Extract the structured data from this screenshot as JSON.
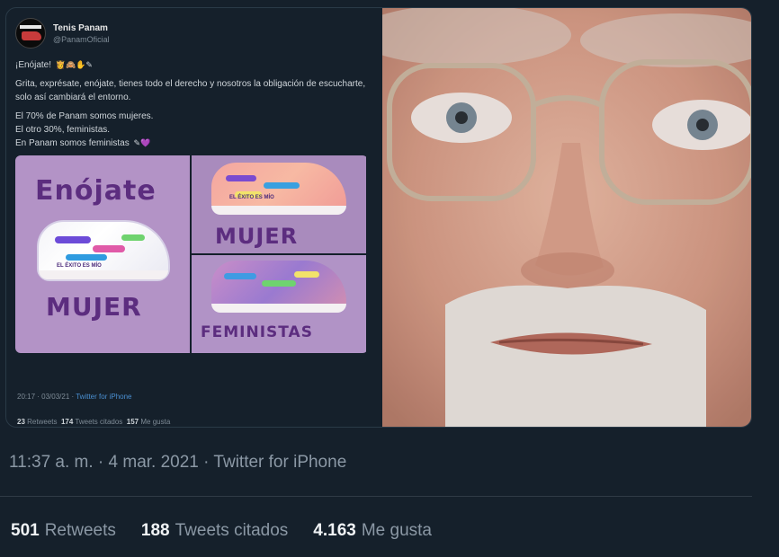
{
  "quoted_tweet": {
    "display_name": "Tenis Panam",
    "handle": "@PanamOficial",
    "line1": "¡Enójate!",
    "line1_emoji": "👸🙈✋✎",
    "para1": "Grita, exprésate, enójate, tienes todo el derecho y nosotros la obligación de escucharte, solo así cambiará el entorno.",
    "para2a": "El 70% de Panam somos mujeres.",
    "para2b": "El otro 30%, feministas.",
    "para2c": "En Panam somos feministas",
    "para2c_emoji": "✎💜",
    "media": {
      "tile1_word_top": "Enójate",
      "tile1_word_bottom": "MUJER",
      "tile2_word": "MUJER",
      "tile3_word": "FEMINISTAS",
      "shoe_scribble": "EL ÉXITO ES MÍO"
    },
    "meta_time": "20:17 · 03/03/21 ·",
    "meta_source": "Twitter for iPhone",
    "retweets": "23",
    "retweets_label": "Retweets",
    "quotes": "174",
    "quotes_label": "Tweets citados",
    "likes": "157",
    "likes_label": "Me gusta"
  },
  "timestamp": "11:37 a. m. · 4 mar. 2021 · Twitter for iPhone",
  "stats": {
    "retweets": "501",
    "retweets_label": "Retweets",
    "quotes": "188",
    "quotes_label": "Tweets citados",
    "likes": "4.163",
    "likes_label": "Me gusta"
  },
  "colors": {
    "background": "#15202b",
    "muted_text": "#8b98a5",
    "link": "#4a8fd1",
    "tile_purple": "#b393c6",
    "ink_purple": "#5c2d7f"
  }
}
